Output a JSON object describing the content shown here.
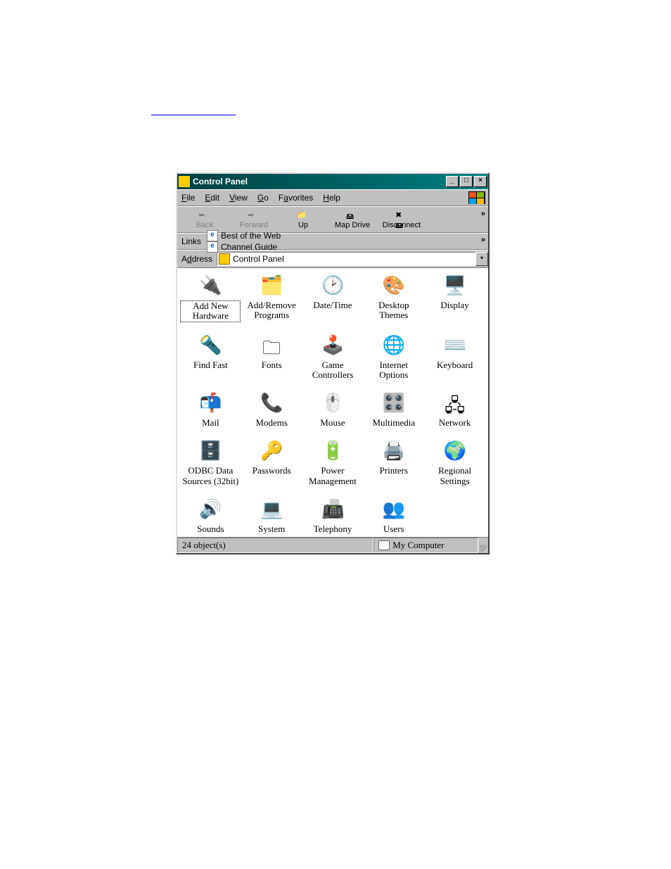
{
  "page_link": "________________",
  "window": {
    "title": "Control Panel",
    "menu": [
      "File",
      "Edit",
      "View",
      "Go",
      "Favorites",
      "Help"
    ],
    "toolbar": [
      {
        "name": "back",
        "label": "Back",
        "enabled": false
      },
      {
        "name": "forward",
        "label": "Forward",
        "enabled": false
      },
      {
        "name": "up",
        "label": "Up",
        "enabled": true
      },
      {
        "name": "mapdrive",
        "label": "Map Drive",
        "enabled": true
      },
      {
        "name": "disconnect",
        "label": "Disconnect",
        "enabled": true
      }
    ],
    "links_label": "Links",
    "links": [
      {
        "name": "best-of-web",
        "label": "Best of the Web"
      },
      {
        "name": "channel-guide",
        "label": "Channel Guide"
      }
    ],
    "address_label": "Address",
    "address_value": "Control Panel",
    "items": [
      {
        "id": "add-new-hardware",
        "label": "Add New Hardware",
        "selected": true
      },
      {
        "id": "add-remove-programs",
        "label": "Add/Remove Programs"
      },
      {
        "id": "date-time",
        "label": "Date/Time"
      },
      {
        "id": "desktop-themes",
        "label": "Desktop Themes"
      },
      {
        "id": "display",
        "label": "Display"
      },
      {
        "id": "find-fast",
        "label": "Find Fast"
      },
      {
        "id": "fonts",
        "label": "Fonts"
      },
      {
        "id": "game-controllers",
        "label": "Game Controllers"
      },
      {
        "id": "internet-options",
        "label": "Internet Options"
      },
      {
        "id": "keyboard",
        "label": "Keyboard"
      },
      {
        "id": "mail",
        "label": "Mail"
      },
      {
        "id": "modems",
        "label": "Modems"
      },
      {
        "id": "mouse",
        "label": "Mouse"
      },
      {
        "id": "multimedia",
        "label": "Multimedia"
      },
      {
        "id": "network",
        "label": "Network"
      },
      {
        "id": "odbc",
        "label": "ODBC Data Sources (32bit)"
      },
      {
        "id": "passwords",
        "label": "Passwords"
      },
      {
        "id": "power-management",
        "label": "Power Management"
      },
      {
        "id": "printers",
        "label": "Printers"
      },
      {
        "id": "regional-settings",
        "label": "Regional Settings"
      },
      {
        "id": "sounds",
        "label": "Sounds"
      },
      {
        "id": "system",
        "label": "System"
      },
      {
        "id": "telephony",
        "label": "Telephony"
      },
      {
        "id": "users",
        "label": "Users"
      }
    ],
    "status_left": "24 object(s)",
    "status_right": "My Computer"
  },
  "icons": {
    "add-new-hardware": "🔌",
    "add-remove-programs": "🗂️",
    "date-time": "🕑",
    "desktop-themes": "🎨",
    "display": "🖥️",
    "find-fast": "🔦",
    "fonts": "🗀",
    "game-controllers": "🕹️",
    "internet-options": "🌐",
    "keyboard": "⌨️",
    "mail": "📬",
    "modems": "📞",
    "mouse": "🖱️",
    "multimedia": "🎛️",
    "network": "🖧",
    "odbc": "🗄️",
    "passwords": "🔑",
    "power-management": "🔋",
    "printers": "🖨️",
    "regional-settings": "🌍",
    "sounds": "🔊",
    "system": "💻",
    "telephony": "📠",
    "users": "👥"
  }
}
